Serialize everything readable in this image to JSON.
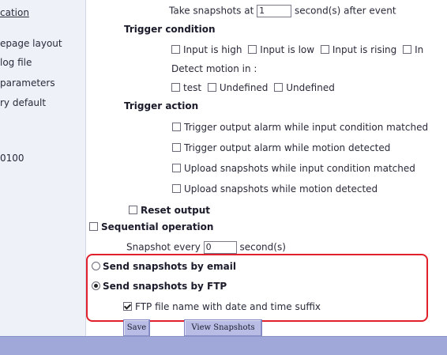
{
  "sidebar": {
    "items": [
      {
        "label": "cation"
      },
      {
        "label": "epage layout"
      },
      {
        "label": "log file"
      },
      {
        "label": "parameters"
      },
      {
        "label": "ry default"
      },
      {
        "label": "0100"
      }
    ]
  },
  "snapshot_delay": {
    "prefix": "Take snapshots at",
    "value": "1",
    "suffix": "second(s) after event"
  },
  "trigger_condition": {
    "title": "Trigger condition",
    "inputs": [
      "Input is high",
      "Input is low",
      "Input is rising",
      "In"
    ],
    "motion_label": "Detect motion in :",
    "motion_windows": [
      "test",
      "Undefined",
      "Undefined"
    ]
  },
  "trigger_action": {
    "title": "Trigger action",
    "options": [
      "Trigger output alarm while input condition matched",
      "Trigger output alarm while motion detected",
      "Upload snapshots while input condition matched",
      "Upload snapshots while motion detected"
    ],
    "reset_output": "Reset output"
  },
  "sequential": {
    "label": "Sequential operation",
    "prefix": "Snapshot every",
    "value": "0",
    "suffix": "second(s)"
  },
  "send": {
    "email": "Send snapshots by email",
    "ftp": "Send snapshots by FTP",
    "ftp_suffix": "FTP file name with date and time suffix",
    "selected": "ftp"
  },
  "buttons": {
    "save": "Save",
    "view": "View Snapshots"
  },
  "colors": {
    "highlight": "#e0202a",
    "button_bg": "#b9bde6",
    "bottom_bar": "#9fa8d8",
    "sidebar_bg": "#eef1f8"
  }
}
